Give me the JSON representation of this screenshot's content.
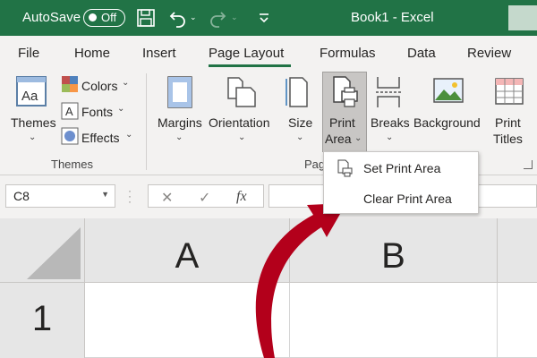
{
  "titlebar": {
    "autosave_label": "AutoSave",
    "autosave_state": "Off",
    "document_title": "Book1  -  Excel",
    "accent": "#217346"
  },
  "tabs": [
    {
      "label": "File"
    },
    {
      "label": "Home"
    },
    {
      "label": "Insert"
    },
    {
      "label": "Page Layout",
      "active": true
    },
    {
      "label": "Formulas"
    },
    {
      "label": "Data"
    },
    {
      "label": "Review"
    }
  ],
  "ribbon": {
    "themes": {
      "label": "Themes",
      "icon": "themes-icon"
    },
    "colors": {
      "label": "Colors",
      "icon": "colors-icon"
    },
    "fonts": {
      "label": "Fonts",
      "icon": "fonts-icon"
    },
    "effects": {
      "label": "Effects",
      "icon": "effects-icon"
    },
    "themes_group_label": "Themes",
    "margins": {
      "label": "Margins",
      "icon": "margins-icon"
    },
    "orientation": {
      "label": "Orientation",
      "icon": "orientation-icon"
    },
    "size": {
      "label": "Size",
      "icon": "size-icon"
    },
    "print_area": {
      "line1": "Print",
      "line2": "Area",
      "icon": "print-area-icon"
    },
    "breaks": {
      "label": "Breaks",
      "icon": "breaks-icon"
    },
    "background": {
      "label": "Background",
      "icon": "background-icon"
    },
    "print_titles": {
      "line1": "Print",
      "line2": "Titles",
      "icon": "print-titles-icon"
    },
    "page_setup_group_label": "Pag"
  },
  "formula_bar": {
    "name_box": "C8",
    "cancel_glyph": "✕",
    "enter_glyph": "✓",
    "fx_glyph": "fx",
    "formula": ""
  },
  "grid": {
    "columns": [
      "A",
      "B"
    ],
    "rows": [
      "1"
    ]
  },
  "dropdown": {
    "items": [
      {
        "label": "Set Print Area",
        "icon": "set-print-area-icon"
      },
      {
        "label": "Clear Print Area",
        "icon": "clear-print-area-icon"
      }
    ]
  },
  "annotation": {
    "arrow_color": "#b3001b"
  }
}
